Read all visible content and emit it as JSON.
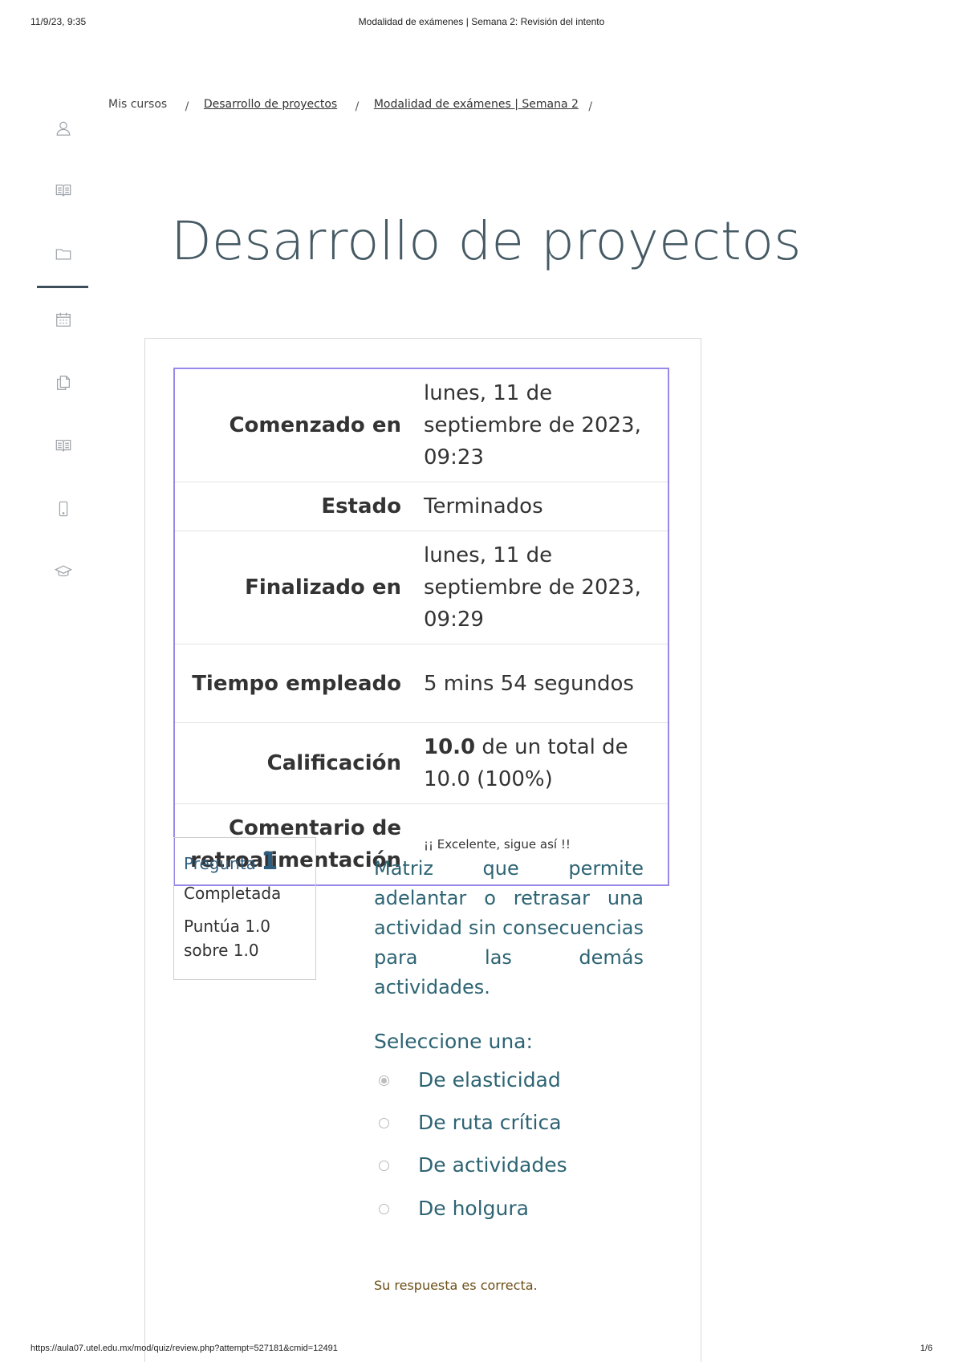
{
  "print": {
    "datetime": "11/9/23, 9:35",
    "title": "Modalidad de exámenes | Semana 2: Revisión del intento",
    "url": "https://aula07.utel.edu.mx/mod/quiz/review.php?attempt=527181&cmid=12491",
    "page": "1/6"
  },
  "breadcrumb": {
    "items": [
      "Mis cursos",
      "Desarrollo de proyectos",
      "Modalidad de exámenes | Semana 2"
    ],
    "separator": "/"
  },
  "sidenav": {
    "icons": [
      "user-icon",
      "book-icon",
      "folder-icon",
      "calendar-icon",
      "documents-icon",
      "book-icon",
      "mobile-icon",
      "graduation-cap-icon"
    ],
    "active_index": 2
  },
  "course_title": "Desarrollo de proyectos",
  "summary": {
    "started_label": "Comenzado en",
    "started_value": "lunes, 11 de septiembre de 2023, 09:23",
    "state_label": "Estado",
    "state_value": "Terminados",
    "finished_label": "Finalizado en",
    "finished_value": "lunes, 11 de septiembre de 2023, 09:29",
    "time_label": "Tiempo empleado",
    "time_value": "5 mins 54 segundos",
    "grade_label": "Calificación",
    "grade_score": "10.0",
    "grade_rest": "de un total de 10.0 (100%)",
    "feedback_label": "Comentario de retroalimentación",
    "feedback_value": "¡¡ Excelente, sigue así !!"
  },
  "question": {
    "label": "Pregunta",
    "number": "1",
    "state": "Completada",
    "grade": "Puntúa 1.0 sobre 1.0",
    "text": "Matriz que permite adelantar o retrasar una actividad sin consecuencias para las demás actividades.",
    "prompt": "Seleccione una:",
    "options": [
      "De elasticidad",
      "De ruta crítica",
      "De actividades",
      "De holgura"
    ],
    "selected_index": 0,
    "feedback": "Su respuesta es correcta."
  }
}
